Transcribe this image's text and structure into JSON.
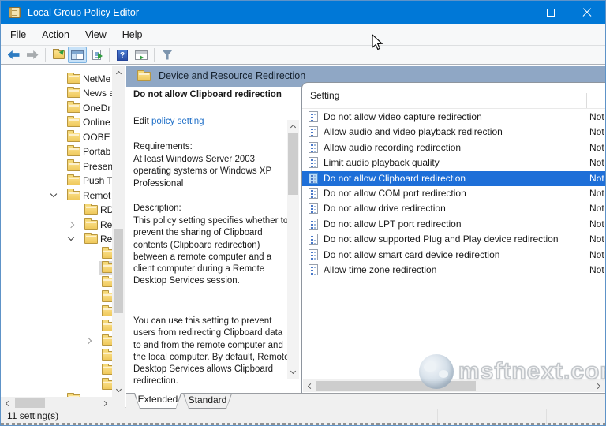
{
  "window": {
    "title": "Local Group Policy Editor"
  },
  "menu": {
    "items": [
      "File",
      "Action",
      "View",
      "Help"
    ]
  },
  "toolbar": {
    "buttons": [
      "back",
      "forward",
      "up-one-level",
      "show-console-tree",
      "export-list",
      "help",
      "show-properties",
      "filter"
    ]
  },
  "header": {
    "title": "Device and Resource Redirection"
  },
  "help_pane": {
    "title": "Do not allow Clipboard redirection",
    "edit_prefix": "Edit ",
    "edit_link": "policy setting",
    "requirements_label": "Requirements:",
    "requirements_text": "At least Windows Server 2003 operating systems or Windows XP Professional",
    "description_label": "Description:",
    "description_p1": "This policy setting specifies whether to prevent the sharing of Clipboard contents (Clipboard redirection) between a remote computer and a client computer during a Remote Desktop Services session.",
    "description_p2": "You can use this setting to prevent users from redirecting Clipboard data to and from the remote computer and the local computer. By default, Remote Desktop Services allows Clipboard redirection."
  },
  "list": {
    "column_header": "Setting",
    "rows": [
      {
        "label": "Do not allow video capture redirection",
        "state": "Not",
        "selected": false
      },
      {
        "label": "Allow audio and video playback redirection",
        "state": "Not",
        "selected": false
      },
      {
        "label": "Allow audio recording redirection",
        "state": "Not",
        "selected": false
      },
      {
        "label": "Limit audio playback quality",
        "state": "Not",
        "selected": false
      },
      {
        "label": "Do not allow Clipboard redirection",
        "state": "Not",
        "selected": true
      },
      {
        "label": "Do not allow COM port redirection",
        "state": "Not",
        "selected": false
      },
      {
        "label": "Do not allow drive redirection",
        "state": "Not",
        "selected": false
      },
      {
        "label": "Do not allow LPT port redirection",
        "state": "Not",
        "selected": false
      },
      {
        "label": "Do not allow supported Plug and Play device redirection",
        "state": "Not",
        "selected": false
      },
      {
        "label": "Do not allow smart card device redirection",
        "state": "Not",
        "selected": false
      },
      {
        "label": "Allow time zone redirection",
        "state": "Not",
        "selected": false
      }
    ]
  },
  "tree": {
    "items": [
      {
        "label": "NetMe",
        "level": 1,
        "chevron": "none",
        "selected": false
      },
      {
        "label": "News a",
        "level": 1,
        "chevron": "none",
        "selected": false
      },
      {
        "label": "OneDr",
        "level": 1,
        "chevron": "none",
        "selected": false
      },
      {
        "label": "Online",
        "level": 1,
        "chevron": "none",
        "selected": false
      },
      {
        "label": "OOBE",
        "level": 1,
        "chevron": "none",
        "selected": false
      },
      {
        "label": "Portab",
        "level": 1,
        "chevron": "none",
        "selected": false
      },
      {
        "label": "Presen",
        "level": 1,
        "chevron": "none",
        "selected": false
      },
      {
        "label": "Push T",
        "level": 1,
        "chevron": "none",
        "selected": false
      },
      {
        "label": "Remot",
        "level": 1,
        "chevron": "open",
        "selected": false
      },
      {
        "label": "RD",
        "level": 2,
        "chevron": "none",
        "selected": false
      },
      {
        "label": "Rer",
        "level": 2,
        "chevron": "closed",
        "selected": false
      },
      {
        "label": "Rer",
        "level": 2,
        "chevron": "open",
        "selected": false
      },
      {
        "label": "",
        "level": 3,
        "chevron": "none",
        "selected": false
      },
      {
        "label": "",
        "level": 3,
        "chevron": "none",
        "selected": true
      },
      {
        "label": "",
        "level": 3,
        "chevron": "none",
        "selected": false
      },
      {
        "label": "",
        "level": 3,
        "chevron": "none",
        "selected": false
      },
      {
        "label": "",
        "level": 3,
        "chevron": "none",
        "selected": false
      },
      {
        "label": "",
        "level": 3,
        "chevron": "none",
        "selected": false
      },
      {
        "label": "",
        "level": 3,
        "chevron": "closed",
        "selected": false
      },
      {
        "label": "",
        "level": 3,
        "chevron": "none",
        "selected": false
      },
      {
        "label": "",
        "level": 3,
        "chevron": "none",
        "selected": false
      },
      {
        "label": "",
        "level": 3,
        "chevron": "none",
        "selected": false
      },
      {
        "label": "",
        "level": 1,
        "chevron": "none",
        "selected": false
      }
    ]
  },
  "tabs": {
    "active": "Extended",
    "inactive": "Standard"
  },
  "status": {
    "text": "11 setting(s)"
  },
  "watermark": {
    "text": "msftnext.com"
  },
  "colors": {
    "titlebar": "#0078D7",
    "band": "#8FA7C5",
    "selection": "#1E6FD8",
    "link": "#2070C8"
  }
}
